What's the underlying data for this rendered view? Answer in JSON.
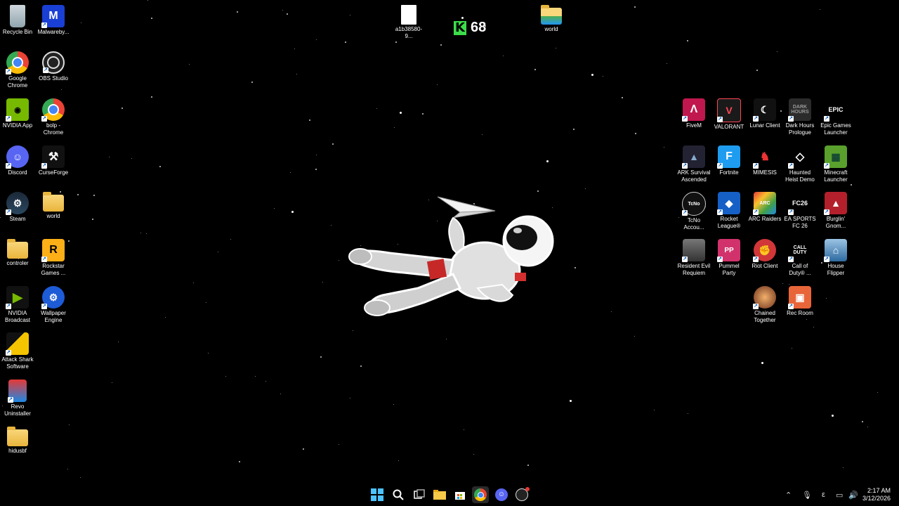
{
  "desktop": {
    "left_icons": [
      {
        "label": "Recycle Bin",
        "icon": "recycle-bin-icon"
      },
      {
        "label": "Malwareby...",
        "icon": "malwarebytes-icon"
      },
      {
        "label": "Google\nChrome",
        "icon": "chrome-icon"
      },
      {
        "label": "OBS Studio",
        "icon": "obs-icon"
      },
      {
        "label": "NVIDIA App",
        "icon": "nvidia-icon"
      },
      {
        "label": "bolp -\nChrome",
        "icon": "chrome-profile-icon"
      },
      {
        "label": "Discord",
        "icon": "discord-icon"
      },
      {
        "label": "CurseForge",
        "icon": "curseforge-icon"
      },
      {
        "label": "Steam",
        "icon": "steam-icon"
      },
      {
        "label": "world",
        "icon": "folder-icon"
      },
      {
        "label": "controler",
        "icon": "folder-icon"
      },
      {
        "label": "Rockstar\nGames ...",
        "icon": "rockstar-icon"
      },
      {
        "label": "NVIDIA\nBroadcast",
        "icon": "nvidia-broadcast-icon"
      },
      {
        "label": "Wallpaper\nEngine",
        "icon": "wallpaper-engine-icon"
      },
      {
        "label": "Attack Shark\nSoftware",
        "icon": "attack-shark-icon"
      },
      {
        "label": "Revo\nUninstaller",
        "icon": "revo-icon"
      },
      {
        "label": "hidusbf",
        "icon": "folder-icon"
      }
    ],
    "top_icons": [
      {
        "label": "a1b38580-9...",
        "icon": "file-icon"
      },
      {
        "label": "world",
        "icon": "folder-icon"
      }
    ],
    "right_icons": [
      {
        "label": "FiveM",
        "icon": "fivem-icon"
      },
      {
        "label": "VALORANT",
        "icon": "valorant-icon"
      },
      {
        "label": "Lunar Client",
        "icon": "lunar-client-icon"
      },
      {
        "label": "Dark Hours\nPrologue",
        "icon": "dark-hours-icon"
      },
      {
        "label": "Epic Games\nLauncher",
        "icon": "epic-games-icon"
      },
      {
        "label": "ARK Survival\nAscended",
        "icon": "ark-icon"
      },
      {
        "label": "Fortnite",
        "icon": "fortnite-icon"
      },
      {
        "label": "MIMESIS",
        "icon": "mimesis-icon"
      },
      {
        "label": "Haunted\nHeist Demo",
        "icon": "haunted-heist-icon"
      },
      {
        "label": "Minecraft\nLauncher",
        "icon": "minecraft-icon"
      },
      {
        "label": "TcNo\nAccou...",
        "icon": "tcno-icon"
      },
      {
        "label": "Rocket\nLeague®",
        "icon": "rocket-league-icon"
      },
      {
        "label": "ARC Raiders",
        "icon": "arc-raiders-icon"
      },
      {
        "label": "EA SPORTS\nFC 26",
        "icon": "ea-fc-icon"
      },
      {
        "label": "Burglin'\nGnom...",
        "icon": "burglin-gnomes-icon"
      },
      {
        "label": "Resident Evil\nRequiem",
        "icon": "resident-evil-icon"
      },
      {
        "label": "Pummel\nParty",
        "icon": "pummel-party-icon"
      },
      {
        "label": "Riot Client",
        "icon": "riot-client-icon"
      },
      {
        "label": "Call of\nDuty® ...",
        "icon": "call-of-duty-icon"
      },
      {
        "label": "House\nFlipper",
        "icon": "house-flipper-icon"
      },
      {
        "label": "Chained\nTogether",
        "icon": "chained-together-icon"
      },
      {
        "label": "Rec Room",
        "icon": "rec-room-icon"
      }
    ]
  },
  "overlay": {
    "kill_counter_logo": "K",
    "kill_counter_value": "68"
  },
  "taskbar": {
    "items": [
      "start-icon",
      "search-icon",
      "task-view-icon",
      "file-explorer-icon",
      "store-icon",
      "chrome-icon",
      "discord-icon",
      "obs-icon"
    ],
    "tray_lang": "ε",
    "time": "2:17 AM",
    "date": "3/12/2026"
  },
  "colors": {
    "background": "#000000",
    "accent_green": "#3ddc4a"
  }
}
